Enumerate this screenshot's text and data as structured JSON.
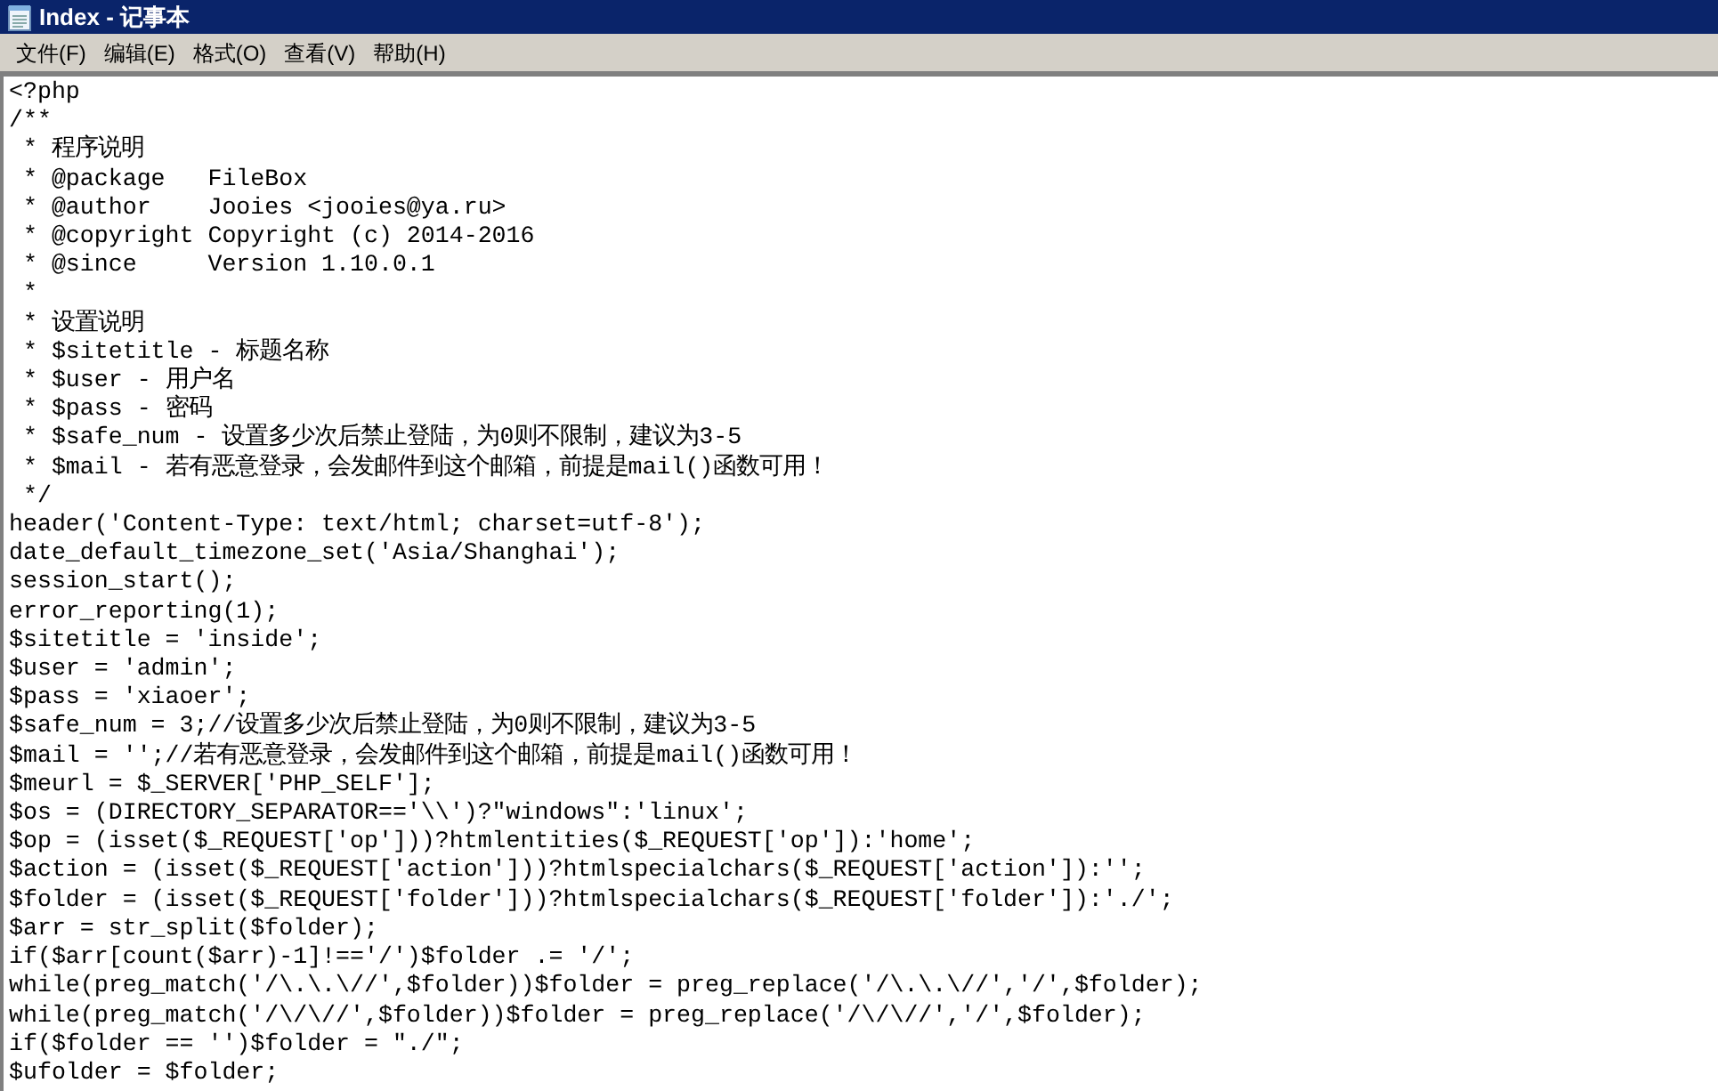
{
  "window": {
    "title": "Index - 记事本"
  },
  "menu": [
    "文件(F)",
    "编辑(E)",
    "格式(O)",
    "查看(V)",
    "帮助(H)"
  ],
  "editor": {
    "lines": [
      "<?php",
      "/**",
      " * 程序说明",
      " * @package   FileBox",
      " * @author    Jooies <jooies@ya.ru>",
      " * @copyright Copyright (c) 2014-2016",
      " * @since     Version 1.10.0.1",
      " *",
      " * 设置说明",
      " * $sitetitle - 标题名称",
      " * $user - 用户名",
      " * $pass - 密码",
      " * $safe_num - 设置多少次后禁止登陆，为0则不限制，建议为3-5",
      " * $mail - 若有恶意登录，会发邮件到这个邮箱，前提是mail()函数可用！",
      " */",
      "header('Content-Type: text/html; charset=utf-8');",
      "date_default_timezone_set('Asia/Shanghai');",
      "session_start();",
      "error_reporting(1);",
      "$sitetitle = 'inside';",
      "$user = 'admin';",
      "$pass = 'xiaoer';",
      "$safe_num = 3;//设置多少次后禁止登陆，为0则不限制，建议为3-5",
      "$mail = '';//若有恶意登录，会发邮件到这个邮箱，前提是mail()函数可用！",
      "$meurl = $_SERVER['PHP_SELF'];",
      "$os = (DIRECTORY_SEPARATOR=='\\\\')?\"windows\":'linux';",
      "$op = (isset($_REQUEST['op']))?htmlentities($_REQUEST['op']):'home';",
      "$action = (isset($_REQUEST['action']))?htmlspecialchars($_REQUEST['action']):'';",
      "$folder = (isset($_REQUEST['folder']))?htmlspecialchars($_REQUEST['folder']):'./';",
      "$arr = str_split($folder);",
      "if($arr[count($arr)-1]!=='/')$folder .= '/';",
      "while(preg_match('/\\.\\.\\//',$folder))$folder = preg_replace('/\\.\\.\\//','/',$folder);",
      "while(preg_match('/\\/\\//',$folder))$folder = preg_replace('/\\/\\//','/',$folder);",
      "if($folder == '')$folder = \"./\";",
      "$ufolder = $folder;"
    ]
  }
}
